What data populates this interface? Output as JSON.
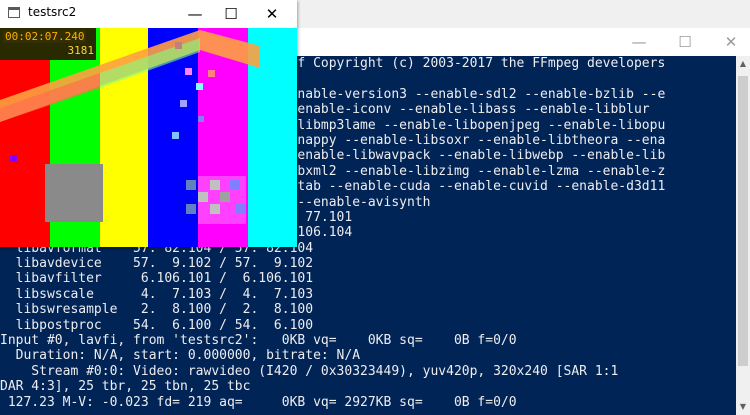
{
  "video_window": {
    "title": "testsrc2",
    "icon": "app-window-icon",
    "controls": {
      "minimize": "—",
      "maximize": "☐",
      "close": "✕"
    },
    "timecode": "00:02:07.240",
    "frame_number": "3181"
  },
  "terminal": {
    "controls": {
      "minimize": "—",
      "maximize": "☐",
      "close": "✕"
    },
    "lines": [
      "                                     3f Copyright (c) 2003-2017 the FFmpeg developers",
      "",
      "                                     enable-version3 --enable-sdl2 --enable-bzlib --e",
      "                                     -enable-iconv --enable-libass --enable-libblur",
      "                                     -libmp3lame --enable-libopenjpeg --enable-libopu",
      "                                     snappy --enable-libsoxr --enable-libtheora --ena",
      "                                     -enable-libwavpack --enable-libwebp --enable-lib",
      "                                     ibxml2 --enable-libzimg --enable-lzma --enable-z",
      "                                     stab --enable-cuda --enable-cuvid --enable-d3d11",
      "                                      --enable-avisynth",
      "                                     . 77.101",
      "                                     .106.104",
      "  libavformat    57. 82.104 / 57. 82.104",
      "  libavdevice    57.  9.102 / 57.  9.102",
      "  libavfilter     6.106.101 /  6.106.101",
      "  libswscale      4.  7.103 /  4.  7.103",
      "  libswresample   2.  8.100 /  2.  8.100",
      "  libpostproc    54.  6.100 / 54.  6.100",
      "Input #0, lavfi, from 'testsrc2':   0KB vq=    0KB sq=    0B f=0/0",
      "  Duration: N/A, start: 0.000000, bitrate: N/A",
      "    Stream #0:0: Video: rawvideo (I420 / 0x30323449), yuv420p, 320x240 [SAR 1:1",
      "DAR 4:3], 25 tbr, 25 tbn, 25 tbc",
      " 127.23 M-V: -0.023 fd= 219 aq=     0KB vq= 2927KB sq=    0B f=0/0"
    ]
  }
}
